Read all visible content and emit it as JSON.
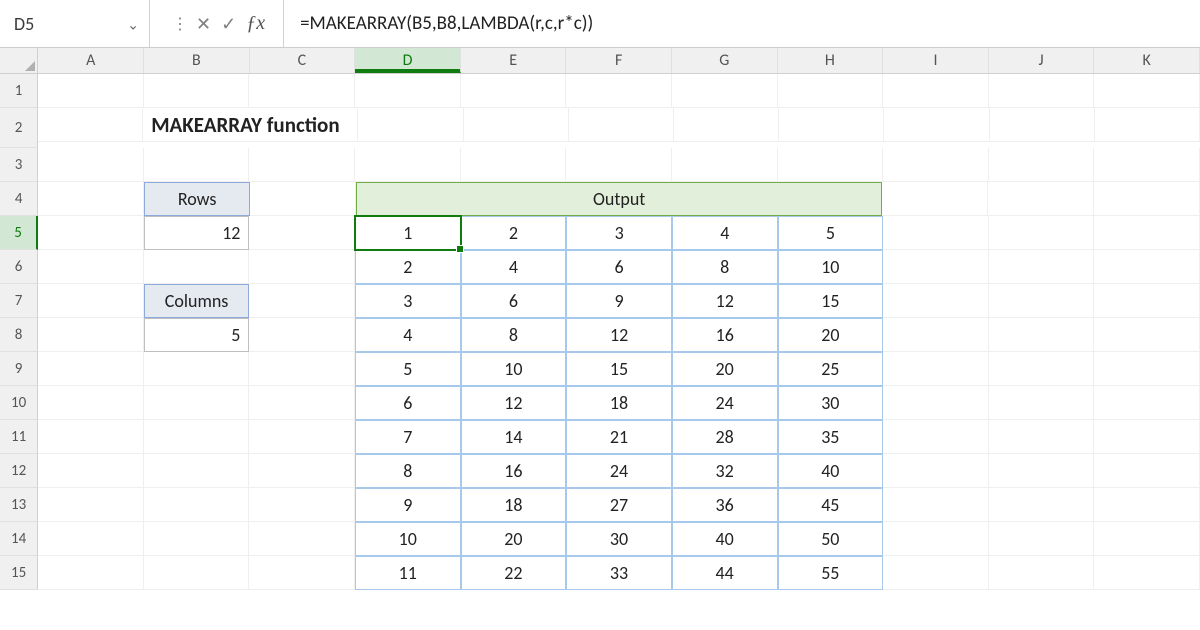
{
  "name_box": "D5",
  "formula": "=MAKEARRAY(B5,B8,LAMBDA(r,c,r*c))",
  "columns": [
    "A",
    "B",
    "C",
    "D",
    "E",
    "F",
    "G",
    "H",
    "I",
    "J",
    "K"
  ],
  "active_col_index": 3,
  "rows": [
    1,
    2,
    3,
    4,
    5,
    6,
    7,
    8,
    9,
    10,
    11,
    12,
    13,
    14,
    15
  ],
  "active_row_index": 4,
  "title": "MAKEARRAY function",
  "inputs": {
    "rows_label": "Rows",
    "rows_value": "12",
    "cols_label": "Columns",
    "cols_value": "5"
  },
  "output_header": "Output",
  "output_table": [
    [
      1,
      2,
      3,
      4,
      5
    ],
    [
      2,
      4,
      6,
      8,
      10
    ],
    [
      3,
      6,
      9,
      12,
      15
    ],
    [
      4,
      8,
      12,
      16,
      20
    ],
    [
      5,
      10,
      15,
      20,
      25
    ],
    [
      6,
      12,
      18,
      24,
      30
    ],
    [
      7,
      14,
      21,
      28,
      35
    ],
    [
      8,
      16,
      24,
      32,
      40
    ],
    [
      9,
      18,
      27,
      36,
      45
    ],
    [
      10,
      20,
      30,
      40,
      50
    ],
    [
      11,
      22,
      33,
      44,
      55
    ]
  ]
}
